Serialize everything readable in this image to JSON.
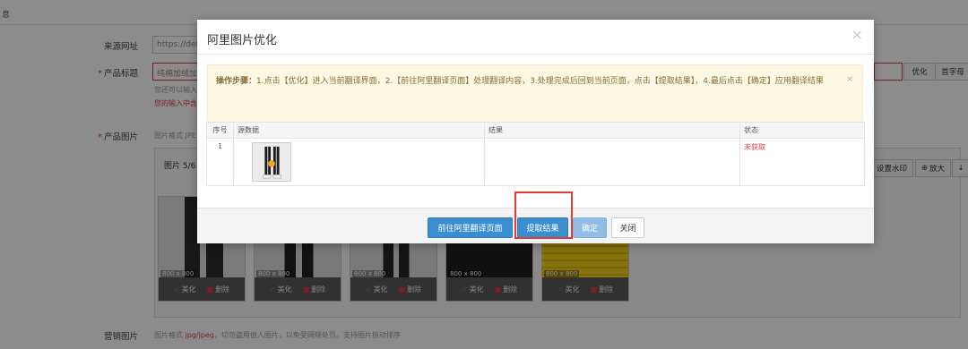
{
  "background": {
    "breadcrumb": "息",
    "fields": {
      "source_url": {
        "label": "来源网址",
        "value": "https://deta"
      },
      "product_title": {
        "label": "产品标题",
        "value": "纯棉加绒加",
        "hint1": "您还可以输入",
        "hint2": "您的输入中含"
      },
      "product_images": {
        "label": "产品图片",
        "format_hint": "图片格式 JPE",
        "gallery_header": "图片 5/6"
      },
      "marketing_images": {
        "label": "营销图片",
        "hint_prefix": "图片格式",
        "hint_format": "jpg/jpeg",
        "hint_rest": "，切勿盗用他人图片，以免受网规处罚。支持图片拖动排序"
      }
    },
    "right_buttons": {
      "optimize": "优化",
      "capitalize": "首字母",
      "watermark": "设置水印",
      "zoom": "放大",
      "download": "↓"
    },
    "thumbnails": [
      {
        "size": "800 x 800",
        "beautify": "美化",
        "delete": "删除"
      },
      {
        "size": "800 x 800",
        "beautify": "美化",
        "delete": "删除"
      },
      {
        "size": "800 x 800",
        "beautify": "美化",
        "delete": "删除"
      },
      {
        "size": "800 x 800",
        "beautify": "美化",
        "delete": "删除"
      },
      {
        "size": "800 x 800",
        "beautify": "美化",
        "delete": "删除"
      }
    ]
  },
  "modal": {
    "title": "阿里图片优化",
    "close": "×",
    "alert": {
      "lead": "操作步骤：",
      "text": "1.点击【优化】进入当前翻译界面，2.【前往阿里翻译页面】处理翻译内容，3.处理完成后回到当前页面，点击【提取结果】，4.最后点击【确定】应用翻译结果",
      "close": "×"
    },
    "table": {
      "headers": {
        "index": "序号",
        "source": "源数据",
        "result": "结果",
        "status": "状态"
      },
      "rows": [
        {
          "index": "1",
          "result": "",
          "status": "未获取"
        }
      ]
    },
    "buttons": {
      "goto_ali": "前往阿里翻译页面",
      "fetch": "提取结果",
      "confirm": "确定",
      "close": "关闭"
    }
  }
}
